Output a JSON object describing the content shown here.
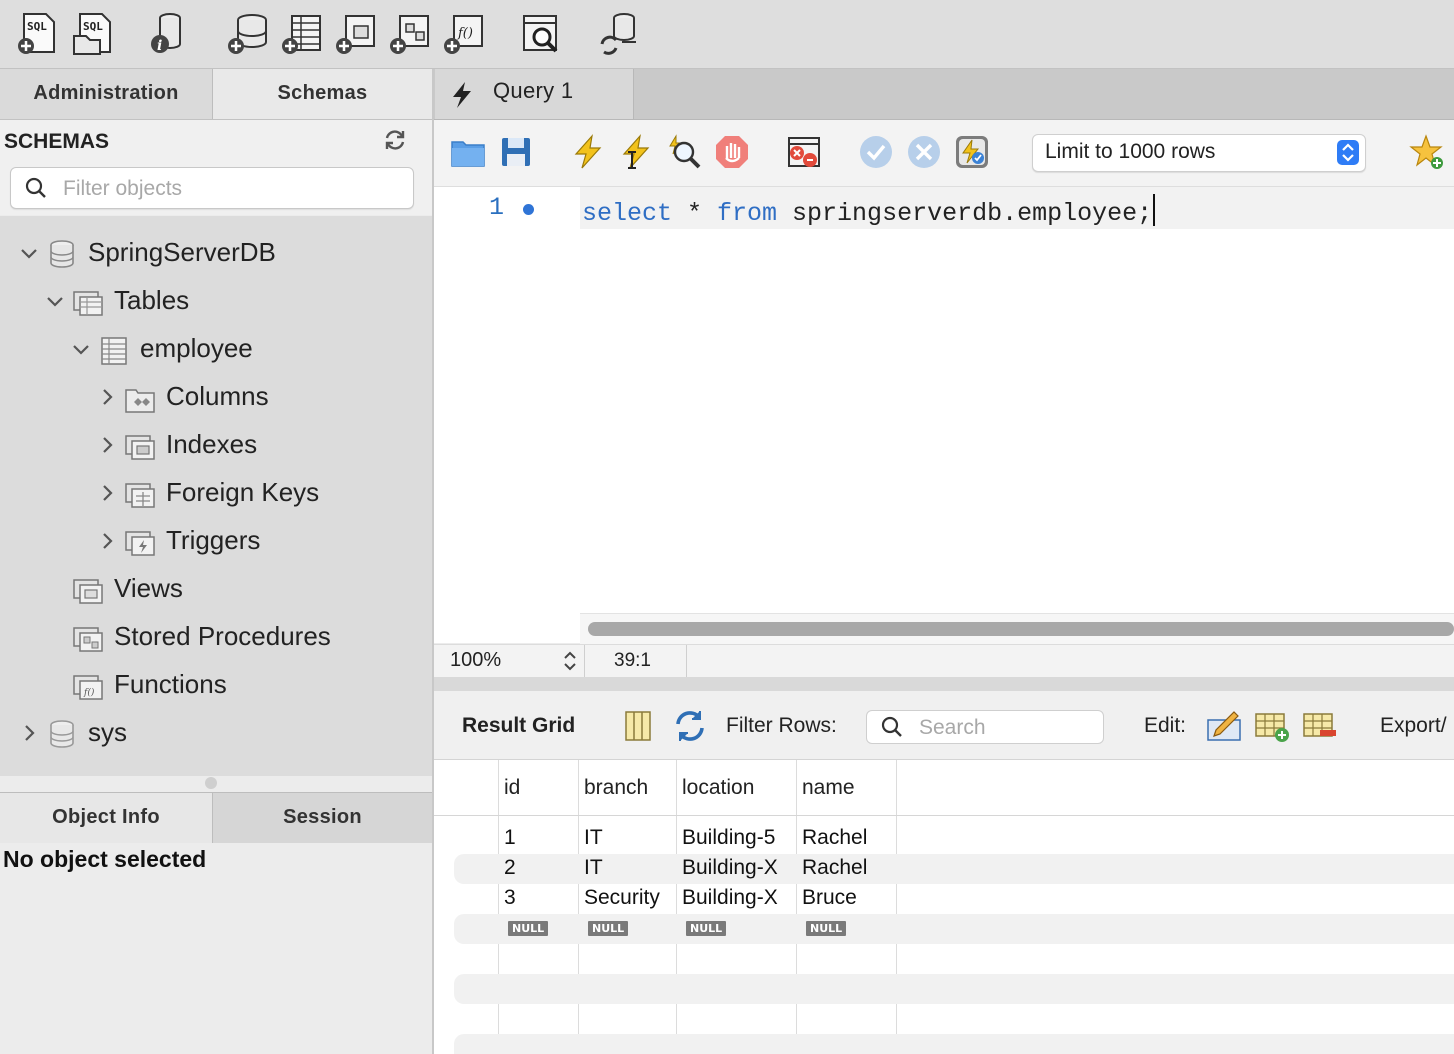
{
  "toolbar": {
    "icons": [
      "new-sql-tab-icon",
      "open-sql-script-icon",
      "schema-inspector-icon",
      "create-schema-icon",
      "create-table-icon",
      "create-view-icon",
      "create-procedure-icon",
      "create-function-icon",
      "search-table-data-icon",
      "reconnect-icon"
    ]
  },
  "left_tabs": {
    "administration": "Administration",
    "schemas": "Schemas"
  },
  "schemas": {
    "title": "SCHEMAS",
    "filter_placeholder": "Filter objects",
    "tree": {
      "db1": "SpringServerDB",
      "tables": "Tables",
      "employee": "employee",
      "columns": "Columns",
      "indexes": "Indexes",
      "foreign_keys": "Foreign Keys",
      "triggers": "Triggers",
      "views": "Views",
      "stored_procedures": "Stored Procedures",
      "functions": "Functions",
      "db2": "sys"
    }
  },
  "bottom_tabs": {
    "object_info": "Object Info",
    "session": "Session"
  },
  "object_info": {
    "message": "No object selected"
  },
  "query_tab": {
    "label": "Query 1"
  },
  "editor_toolbar": {
    "limit": "Limit to 1000 rows"
  },
  "editor": {
    "line_number": "1",
    "code": {
      "kw1": "select",
      "op": " * ",
      "kw2": "from",
      "rest": " springserverdb.employee;"
    }
  },
  "status": {
    "zoom": "100%",
    "cursor": "39:1"
  },
  "result": {
    "label": "Result Grid",
    "filter_label": "Filter Rows:",
    "search_placeholder": "Search",
    "edit_label": "Edit:",
    "export_label": "Export/"
  },
  "grid": {
    "columns": [
      "id",
      "branch",
      "location",
      "name"
    ],
    "rows": [
      [
        "1",
        "IT",
        "Building-5",
        "Rachel"
      ],
      [
        "2",
        "IT",
        "Building-X",
        "Rachel"
      ],
      [
        "3",
        "Security",
        "Building-X",
        "Bruce"
      ]
    ],
    "null_label": "NULL"
  },
  "colors": {
    "accent": "#2e7cf6",
    "keyword": "#2f6ec4"
  }
}
